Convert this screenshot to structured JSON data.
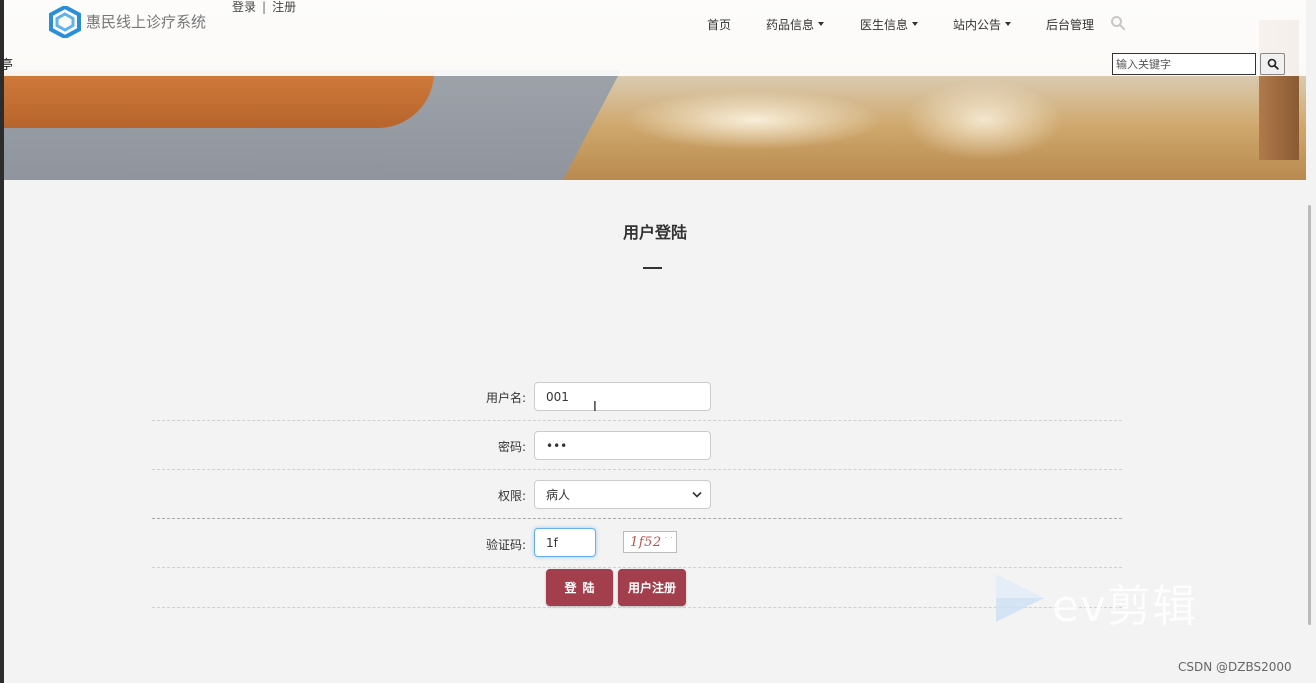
{
  "header": {
    "brand": "惠民线上诊疗系统",
    "login_link": "登录",
    "separator": "|",
    "register_link": "注册",
    "side_glyph": "亭"
  },
  "nav": {
    "items": [
      {
        "label": "首页",
        "dropdown": false
      },
      {
        "label": "药品信息",
        "dropdown": true
      },
      {
        "label": "医生信息",
        "dropdown": true
      },
      {
        "label": "站内公告",
        "dropdown": true
      },
      {
        "label": "后台管理",
        "dropdown": false
      }
    ],
    "search_icon": "search-icon"
  },
  "search": {
    "placeholder": "输入关键字",
    "button_icon": "search-icon"
  },
  "login": {
    "title": "用户登陆",
    "username_label": "用户名:",
    "username_value": "001",
    "password_label": "密码:",
    "password_value": "•••",
    "role_label": "权限:",
    "role_value": "病人",
    "captcha_label": "验证码:",
    "captcha_input": "1f",
    "captcha_image_text": "1f52",
    "login_button": "登陆",
    "register_button": "用户注册"
  },
  "colors": {
    "button": "#a33e4c",
    "logo": "#2a8fd8"
  },
  "watermark": {
    "text": "ev剪辑",
    "credit": "CSDN @DZBS2000"
  }
}
